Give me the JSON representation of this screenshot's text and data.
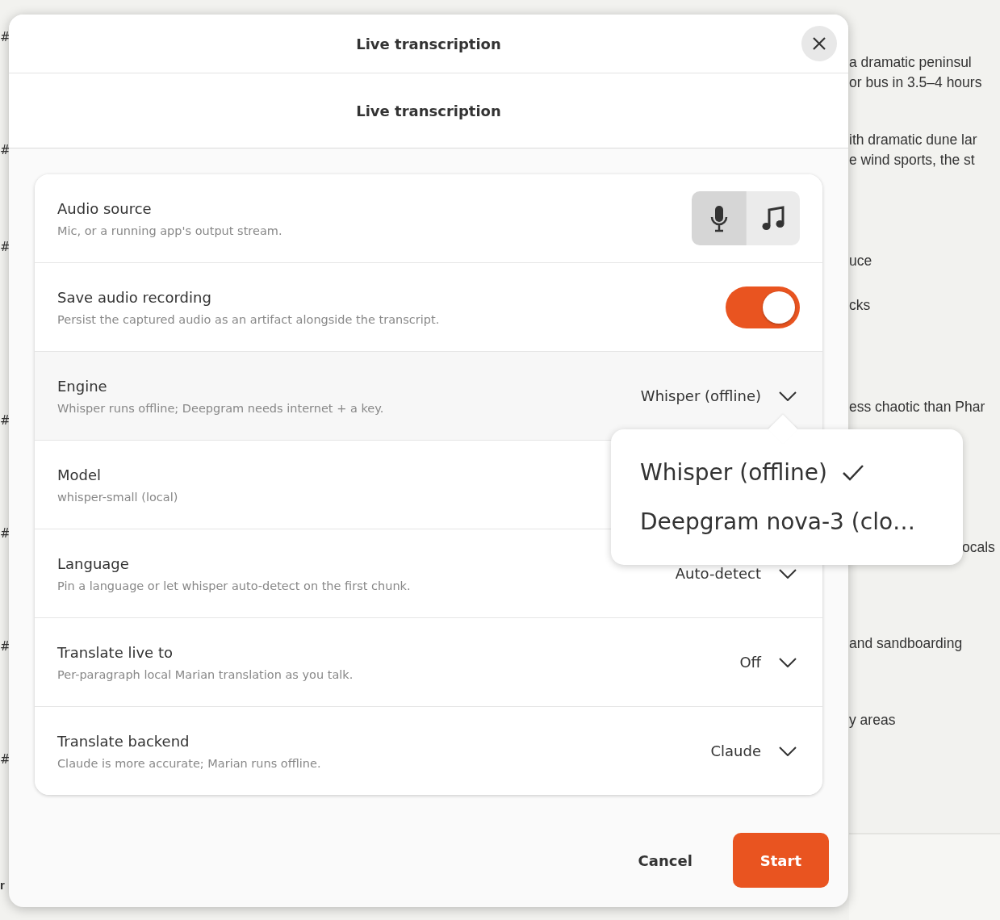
{
  "background": {
    "left_marks": [
      "#",
      "#",
      "#",
      "#",
      "#",
      "#",
      "#"
    ],
    "left_label": "r",
    "lines": [
      {
        "text": "a dramatic peninsul"
      },
      {
        "text": "or bus in 3.5–4 hours"
      },
      {
        "text": "ith dramatic dune lar"
      },
      {
        "text": "e wind sports, the st"
      },
      {
        "text": "uce"
      },
      {
        "text": "cks"
      },
      {
        "text": "ess chaotic than Phar"
      },
      {
        "text": "ocals"
      },
      {
        "text": "and sandboarding"
      },
      {
        "text": "y areas"
      }
    ]
  },
  "dialog": {
    "title": "Live transcription",
    "subtitle": "Live transcription",
    "rows": [
      {
        "kind": "segmented",
        "label": "Audio source",
        "hint": "Mic, or a running app's output stream.",
        "options": [
          {
            "selected": true
          },
          {
            "selected": false
          }
        ]
      },
      {
        "kind": "switch",
        "label": "Save audio recording",
        "hint": "Persist the captured audio as an artifact alongside the transcript.",
        "on": true
      },
      {
        "kind": "dropdown",
        "label": "Engine",
        "hint": "Whisper runs offline; Deepgram needs internet + a key.",
        "value": "Whisper (offline)",
        "menu": [
          {
            "label": "Whisper (offline)",
            "selected": true
          },
          {
            "label": "Deepgram nova-3 (clo…",
            "selected": false
          }
        ]
      },
      {
        "kind": "dropdown",
        "label": "Model",
        "hint": "whisper-small (local)"
      },
      {
        "kind": "dropdown",
        "label": "Language",
        "hint": "Pin a language or let whisper auto-detect on the first chunk.",
        "value": "Auto-detect"
      },
      {
        "kind": "dropdown",
        "label": "Translate live to",
        "hint": "Per-paragraph local Marian translation as you talk.",
        "value": "Off"
      },
      {
        "kind": "dropdown",
        "label": "Translate backend",
        "hint": "Claude is more accurate; Marian runs offline.",
        "value": "Claude"
      }
    ],
    "buttons": [
      {
        "label": "Cancel",
        "kind": "secondary"
      },
      {
        "label": "Start",
        "kind": "primary"
      }
    ]
  }
}
